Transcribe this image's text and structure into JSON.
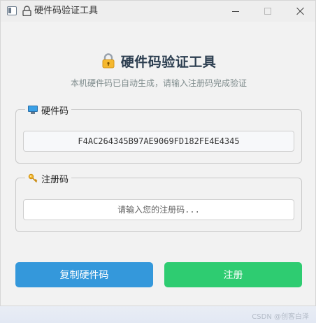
{
  "window": {
    "title": "硬件码验证工具"
  },
  "header": {
    "title": "硬件码验证工具",
    "subtitle": "本机硬件码已自动生成，请输入注册码完成验证"
  },
  "hardware_group": {
    "label": "硬件码",
    "value": "F4AC264345B97AE9069FD182FE4E4345"
  },
  "register_group": {
    "label": "注册码",
    "placeholder": "请输入您的注册码...",
    "value": ""
  },
  "buttons": {
    "copy_label": "复制硬件码",
    "register_label": "注册"
  },
  "watermark": "CSDN @创客白泽",
  "colors": {
    "copy_button": "#3498db",
    "register_button": "#2ecc71",
    "title_text": "#2c3e50"
  }
}
